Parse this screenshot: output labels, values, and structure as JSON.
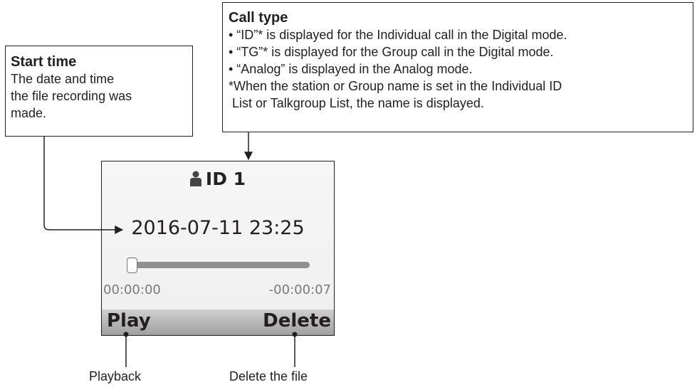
{
  "start_time": {
    "heading": "Start time",
    "lines": [
      "The date and time",
      "the file recording was",
      "made."
    ]
  },
  "call_type": {
    "heading": "Call type",
    "lines": [
      "• “ID”* is displayed for the Individual call in the Digital mode.",
      "• “TG”* is displayed for the Group call in the Digital mode.",
      "• “Analog” is displayed in the Analog mode.",
      "*When the station or Group name is set in the Individual ID",
      " List or Talkgroup List, the name is displayed."
    ]
  },
  "screen": {
    "call_icon": "person-icon",
    "call_label": "ID 1",
    "datetime": "2016-07-11 23:25",
    "progress": 0,
    "elapsed": "00:00:00",
    "remaining": "-00:00:07",
    "softkey_left": "Play",
    "softkey_right": "Delete"
  },
  "captions": {
    "play": "Playback",
    "delete": "Delete the file"
  }
}
